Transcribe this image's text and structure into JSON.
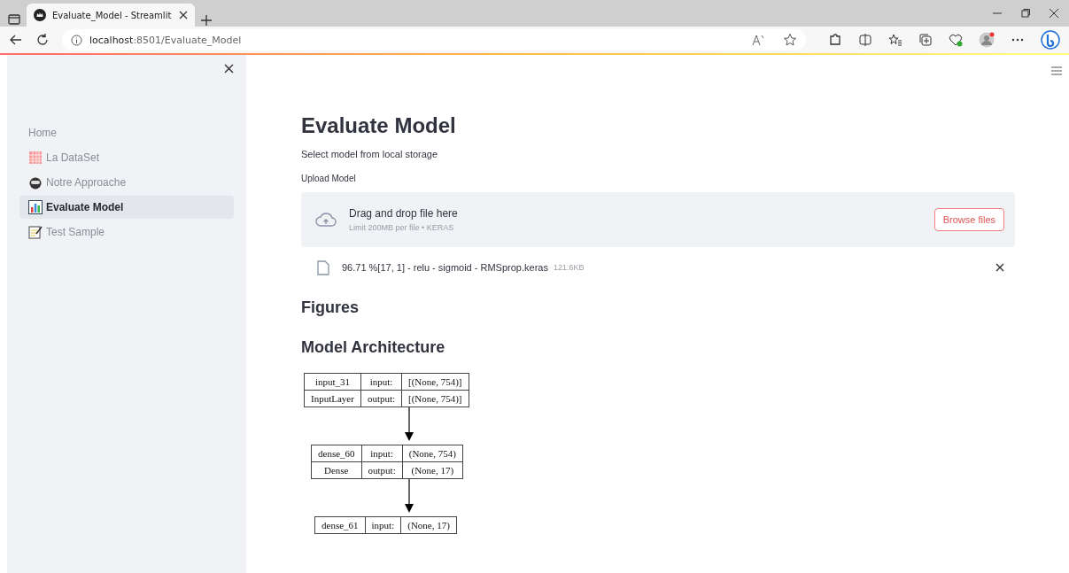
{
  "browser": {
    "tab_title": "Evaluate_Model - Streamlit",
    "url_host": "localhost",
    "url_path": ":8501/Evaluate_Model"
  },
  "sidebar": {
    "items": [
      {
        "label": "Home",
        "selected": false
      },
      {
        "label": "La DataSet",
        "selected": false
      },
      {
        "label": "Notre Approache",
        "selected": false
      },
      {
        "label": "Evaluate Model",
        "selected": true
      },
      {
        "label": "Test Sample",
        "selected": false
      }
    ]
  },
  "main": {
    "title": "Evaluate Model",
    "description": "Select model from local storage",
    "uploader": {
      "label": "Upload Model",
      "drop_text": "Drag and drop file here",
      "limit_text": "Limit 200MB per file • KERAS",
      "button": "Browse files"
    },
    "file": {
      "name": "96.71 %[17, 1] - relu - sigmoid - RMSprop.keras",
      "size": "121.6KB"
    },
    "figures_heading": "Figures",
    "architecture_heading": "Model Architecture",
    "layers": [
      {
        "rows": [
          [
            "input_31",
            "input:",
            "[(None, 754)]"
          ],
          [
            "InputLayer",
            "output:",
            "[(None, 754)]"
          ]
        ]
      },
      {
        "rows": [
          [
            "dense_60",
            "input:",
            "(None, 754)"
          ],
          [
            "Dense",
            "output:",
            "(None, 17)"
          ]
        ]
      },
      {
        "rows": [
          [
            "dense_61",
            "input:",
            "(None, 17)"
          ]
        ]
      }
    ]
  }
}
